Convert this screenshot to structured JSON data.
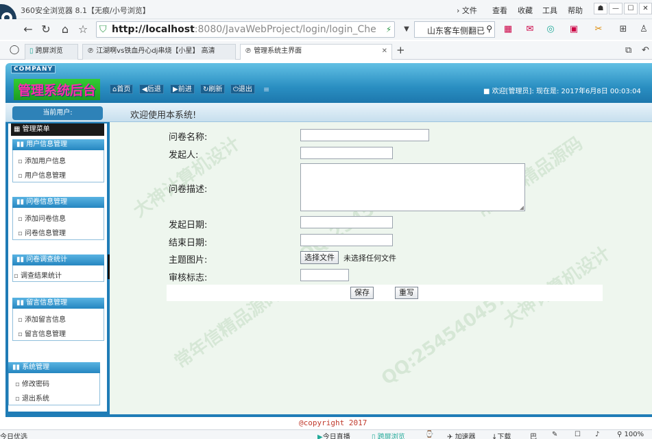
{
  "browser": {
    "window_title": "360安全浏览器 8.1【无痕/小号浏览】",
    "menu": [
      "文件",
      "查看",
      "收藏",
      "工具",
      "帮助"
    ],
    "url_host": "http://localhost",
    "url_rest": ":8080/JavaWebProject/login/login_Che",
    "search_text": "山东客车侧翻已",
    "tabs": [
      {
        "label": "跨屏浏览"
      },
      {
        "label": "江湖啊vs铁血丹心dj串烧【小星】 高清"
      },
      {
        "label": "管理系统主界面"
      }
    ],
    "new_tab": "+"
  },
  "header": {
    "company": "COMPANY",
    "title": "管理系统后台",
    "buttons": [
      "首页",
      "后退",
      "前进",
      "刷新",
      "退出"
    ],
    "welcome": "欢迎[管理员]:   现在是: 2017年6月8日 00:03:04"
  },
  "sidebar": {
    "current_user": "当前用户:",
    "menu_title": "管理菜单",
    "groups": [
      {
        "title": "用户信息管理",
        "items": [
          "添加用户信息",
          "用户信息管理"
        ]
      },
      {
        "title": "问卷信息管理",
        "items": [
          "添加问卷信息",
          "问卷信息管理"
        ]
      },
      {
        "title": "问卷调查统计",
        "items": [
          "调查结果统计"
        ]
      },
      {
        "title": "留言信息管理",
        "items": [
          "添加留言信息",
          "留言信息管理"
        ]
      },
      {
        "title": "系统管理",
        "items": [
          "修改密码",
          "退出系统"
        ]
      }
    ]
  },
  "main": {
    "welcome_title": "欢迎使用本系统!",
    "form": {
      "name_label": "问卷名称:",
      "initiator_label": "发起人:",
      "desc_label": "问卷描述:",
      "start_label": "发起日期:",
      "end_label": "结束日期:",
      "image_label": "主题图片:",
      "review_label": "审核标志:",
      "file_button": "选择文件",
      "file_status": "未选择任何文件",
      "save": "保存",
      "reset": "重写"
    },
    "copyright": "@copyright 2017"
  },
  "statusbar": {
    "left": "今日优选",
    "items": [
      "今日直播",
      "跨屏浏览",
      "加速器",
      "下载"
    ],
    "zoom": "100%"
  }
}
